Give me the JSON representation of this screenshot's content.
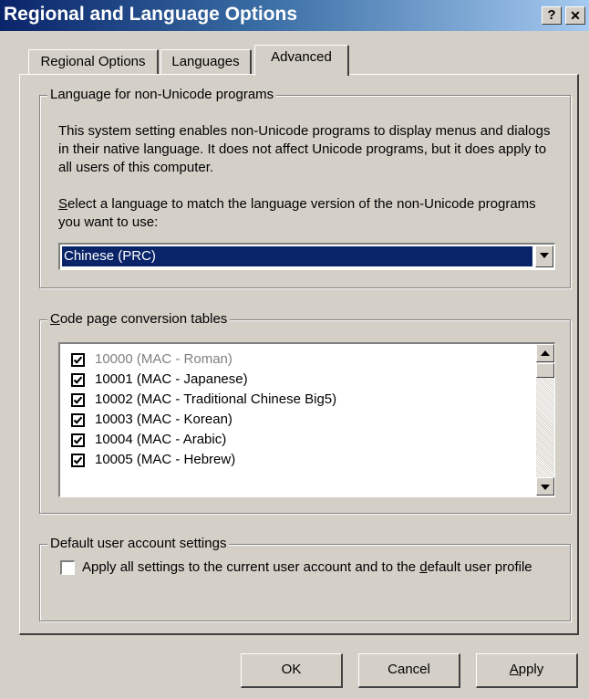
{
  "window": {
    "title": "Regional and Language Options",
    "help_label": "?",
    "close_label": "✕"
  },
  "tabs": [
    {
      "label": "Regional Options",
      "active": false
    },
    {
      "label": "Languages",
      "active": false
    },
    {
      "label": "Advanced",
      "active": true
    }
  ],
  "language_group": {
    "legend": "Language for non-Unicode programs",
    "description": "This system setting enables non-Unicode programs to display menus and dialogs in their native language. It does not affect Unicode programs, but it does apply to all users of this computer.",
    "select_prompt_first": "S",
    "select_prompt_rest": "elect a language to match the language version of the non-Unicode programs you want to use:",
    "selected_language": "Chinese (PRC)"
  },
  "codepage_group": {
    "legend_first": "C",
    "legend_rest": "ode page conversion tables",
    "items": [
      {
        "label": "10000 (MAC - Roman)",
        "checked": true,
        "disabled": true
      },
      {
        "label": "10001 (MAC - Japanese)",
        "checked": true,
        "disabled": false
      },
      {
        "label": "10002 (MAC - Traditional Chinese Big5)",
        "checked": true,
        "disabled": false
      },
      {
        "label": "10003 (MAC - Korean)",
        "checked": true,
        "disabled": false
      },
      {
        "label": "10004 (MAC - Arabic)",
        "checked": true,
        "disabled": false
      },
      {
        "label": "10005 (MAC - Hebrew)",
        "checked": true,
        "disabled": false
      }
    ]
  },
  "default_group": {
    "legend": "Default user account settings",
    "checkbox_text_before": "Apply all settings to the current user account and to the ",
    "checkbox_text_ul": "d",
    "checkbox_text_after": "efault user profile",
    "checked": false
  },
  "buttons": {
    "ok": "OK",
    "cancel": "Cancel",
    "apply_first": "A",
    "apply_rest": "pply"
  },
  "colors": {
    "title_start": "#0a246a",
    "title_end": "#a6caf0",
    "face": "#d4d0c8",
    "selection": "#0a246a",
    "disabled_text": "#808080"
  }
}
